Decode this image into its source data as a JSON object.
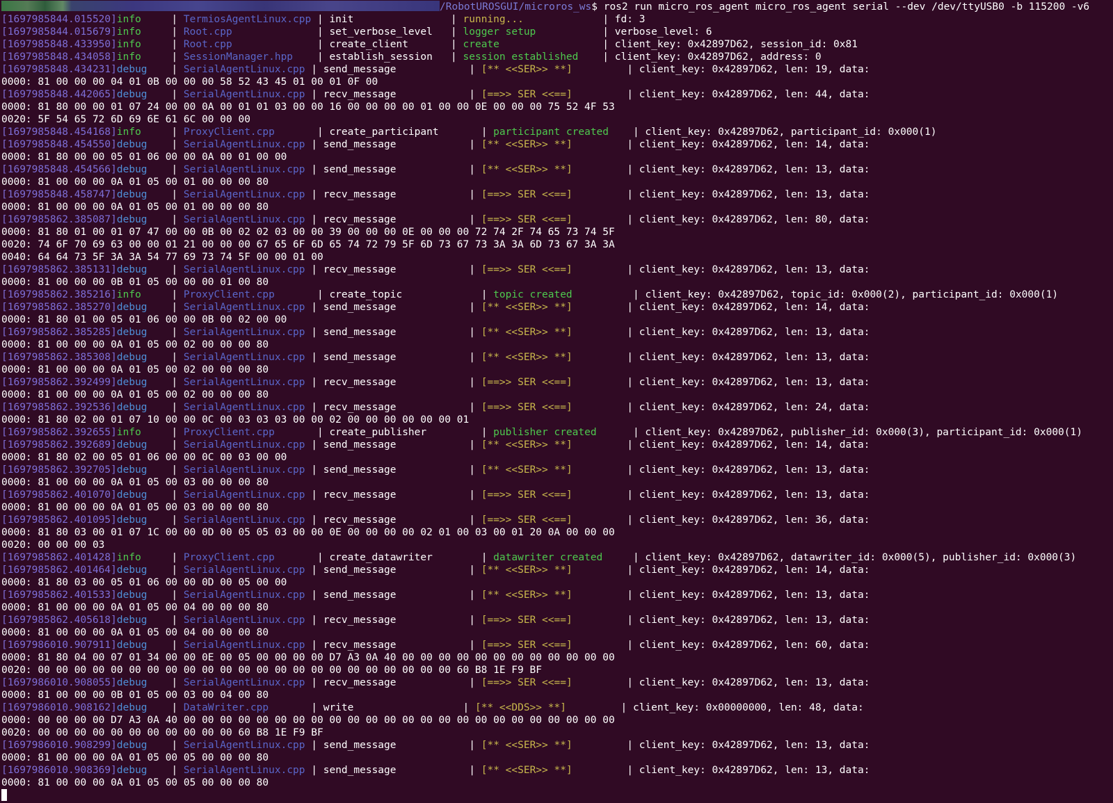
{
  "theme": {
    "background": "#300a24",
    "text": "#ffffff",
    "timestamp": "#7e6fd8",
    "info": "#4ec94e",
    "debug": "#4f8fd8",
    "source": "#5a66c9",
    "status_green": "#4ec94e",
    "status_yellow": "#c9b84c",
    "path": "#7b7bd6"
  },
  "prompt": {
    "path": "/RobotUROSGUI/microros_ws",
    "command": "$ ros2 run micro_ros_agent micro_ros_agent serial --dev /dev/ttyUSB0 -b 115200 -v6"
  },
  "lines": [
    {
      "type": "log",
      "ts": "[1697985844.015520]",
      "level": "info",
      "sep1": "     | ",
      "src": "TermiosAgentLinux.cpp",
      "sep2": " | ",
      "func": "init",
      "pad": "                ",
      "sep3": "| ",
      "status": "running...",
      "status_color": "yellow",
      "sep4": "             | ",
      "msg": "fd: 3"
    },
    {
      "type": "log",
      "ts": "[1697985844.015679]",
      "level": "info",
      "sep1": "     | ",
      "src": "Root.cpp",
      "sep2": "              | ",
      "func": "set_verbose_level",
      "pad": "   ",
      "sep3": "| ",
      "status": "logger setup",
      "status_color": "green",
      "sep4": "           | ",
      "msg": "verbose_level: 6"
    },
    {
      "type": "log",
      "ts": "[1697985848.433950]",
      "level": "info",
      "sep1": "     | ",
      "src": "Root.cpp",
      "sep2": "              | ",
      "func": "create_client",
      "pad": "       ",
      "sep3": "| ",
      "status": "create",
      "status_color": "green",
      "sep4": "                 | ",
      "msg": "client_key: 0x42897D62, session_id: 0x81"
    },
    {
      "type": "log",
      "ts": "[1697985848.434058]",
      "level": "info",
      "sep1": "     | ",
      "src": "SessionManager.hpp",
      "sep2": "    | ",
      "func": "establish_session",
      "pad": "   ",
      "sep3": "| ",
      "status": "session established",
      "status_color": "green",
      "sep4": "    | ",
      "msg": "client_key: 0x42897D62, address: 0"
    },
    {
      "type": "log",
      "ts": "[1697985848.434231]",
      "level": "debug",
      "sep1": "    | ",
      "src": "SerialAgentLinux.cpp",
      "sep2": " | ",
      "func": "send_message",
      "pad": "            ",
      "sep3": "| ",
      "status": "[** <<SER>> **]",
      "status_color": "yellow",
      "sep4": "         | ",
      "msg": "client_key: 0x42897D62, len: 19, data:"
    },
    {
      "type": "hex",
      "text": "0000: 81 00 00 00 04 01 0B 00 00 00 58 52 43 45 01 00 01 0F 00"
    },
    {
      "type": "log",
      "ts": "[1697985848.442065]",
      "level": "debug",
      "sep1": "    | ",
      "src": "SerialAgentLinux.cpp",
      "sep2": " | ",
      "func": "recv_message",
      "pad": "            ",
      "sep3": "| ",
      "status": "[==>> SER <<==]",
      "status_color": "yellow",
      "sep4": "         | ",
      "msg": "client_key: 0x42897D62, len: 44, data:"
    },
    {
      "type": "hex",
      "text": "0000: 81 80 00 00 01 07 24 00 00 0A 00 01 01 03 00 00 16 00 00 00 00 01 00 00 0E 00 00 00 75 52 4F 53"
    },
    {
      "type": "hex",
      "text": "0020: 5F 54 65 72 6D 69 6E 61 6C 00 00 00"
    },
    {
      "type": "log",
      "ts": "[1697985848.454168]",
      "level": "info",
      "sep1": "     | ",
      "src": "ProxyClient.cpp",
      "sep2": "       | ",
      "func": "create_participant",
      "pad": "       ",
      "sep3": "| ",
      "status": "participant created",
      "status_color": "green",
      "sep4": "    | ",
      "msg": "client_key: 0x42897D62, participant_id: 0x000(1)"
    },
    {
      "type": "log",
      "ts": "[1697985848.454550]",
      "level": "debug",
      "sep1": "    | ",
      "src": "SerialAgentLinux.cpp",
      "sep2": " | ",
      "func": "send_message",
      "pad": "            ",
      "sep3": "| ",
      "status": "[** <<SER>> **]",
      "status_color": "yellow",
      "sep4": "         | ",
      "msg": "client_key: 0x42897D62, len: 14, data:"
    },
    {
      "type": "hex",
      "text": "0000: 81 80 00 00 05 01 06 00 00 0A 00 01 00 00"
    },
    {
      "type": "log",
      "ts": "[1697985848.454566]",
      "level": "debug",
      "sep1": "    | ",
      "src": "SerialAgentLinux.cpp",
      "sep2": " | ",
      "func": "send_message",
      "pad": "            ",
      "sep3": "| ",
      "status": "[** <<SER>> **]",
      "status_color": "yellow",
      "sep4": "         | ",
      "msg": "client_key: 0x42897D62, len: 13, data:"
    },
    {
      "type": "hex",
      "text": "0000: 81 00 00 00 0A 01 05 00 01 00 00 00 80"
    },
    {
      "type": "log",
      "ts": "[1697985848.458747]",
      "level": "debug",
      "sep1": "    | ",
      "src": "SerialAgentLinux.cpp",
      "sep2": " | ",
      "func": "recv_message",
      "pad": "            ",
      "sep3": "| ",
      "status": "[==>> SER <<==]",
      "status_color": "yellow",
      "sep4": "         | ",
      "msg": "client_key: 0x42897D62, len: 13, data:"
    },
    {
      "type": "hex",
      "text": "0000: 81 00 00 00 0A 01 05 00 01 00 00 00 80"
    },
    {
      "type": "log",
      "ts": "[1697985862.385087]",
      "level": "debug",
      "sep1": "    | ",
      "src": "SerialAgentLinux.cpp",
      "sep2": " | ",
      "func": "recv_message",
      "pad": "            ",
      "sep3": "| ",
      "status": "[==>> SER <<==]",
      "status_color": "yellow",
      "sep4": "         | ",
      "msg": "client_key: 0x42897D62, len: 80, data:"
    },
    {
      "type": "hex",
      "text": "0000: 81 80 01 00 01 07 47 00 00 0B 00 02 02 03 00 00 39 00 00 00 0E 00 00 00 72 74 2F 74 65 73 74 5F"
    },
    {
      "type": "hex",
      "text": "0020: 74 6F 70 69 63 00 00 01 21 00 00 00 67 65 6F 6D 65 74 72 79 5F 6D 73 67 73 3A 3A 6D 73 67 3A 3A"
    },
    {
      "type": "hex",
      "text": "0040: 64 64 73 5F 3A 3A 54 77 69 73 74 5F 00 00 01 00"
    },
    {
      "type": "log",
      "ts": "[1697985862.385131]",
      "level": "debug",
      "sep1": "    | ",
      "src": "SerialAgentLinux.cpp",
      "sep2": " | ",
      "func": "recv_message",
      "pad": "            ",
      "sep3": "| ",
      "status": "[==>> SER <<==]",
      "status_color": "yellow",
      "sep4": "         | ",
      "msg": "client_key: 0x42897D62, len: 13, data:"
    },
    {
      "type": "hex",
      "text": "0000: 81 00 00 00 0B 01 05 00 00 00 01 00 80"
    },
    {
      "type": "log",
      "ts": "[1697985862.385216]",
      "level": "info",
      "sep1": "     | ",
      "src": "ProxyClient.cpp",
      "sep2": "       | ",
      "func": "create_topic",
      "pad": "             ",
      "sep3": "| ",
      "status": "topic created",
      "status_color": "green",
      "sep4": "          | ",
      "msg": "client_key: 0x42897D62, topic_id: 0x000(2), participant_id: 0x000(1)"
    },
    {
      "type": "log",
      "ts": "[1697985862.385270]",
      "level": "debug",
      "sep1": "    | ",
      "src": "SerialAgentLinux.cpp",
      "sep2": " | ",
      "func": "send_message",
      "pad": "            ",
      "sep3": "| ",
      "status": "[** <<SER>> **]",
      "status_color": "yellow",
      "sep4": "         | ",
      "msg": "client_key: 0x42897D62, len: 14, data:"
    },
    {
      "type": "hex",
      "text": "0000: 81 80 01 00 05 01 06 00 00 0B 00 02 00 00"
    },
    {
      "type": "log",
      "ts": "[1697985862.385285]",
      "level": "debug",
      "sep1": "    | ",
      "src": "SerialAgentLinux.cpp",
      "sep2": " | ",
      "func": "send_message",
      "pad": "            ",
      "sep3": "| ",
      "status": "[** <<SER>> **]",
      "status_color": "yellow",
      "sep4": "         | ",
      "msg": "client_key: 0x42897D62, len: 13, data:"
    },
    {
      "type": "hex",
      "text": "0000: 81 00 00 00 0A 01 05 00 02 00 00 00 80"
    },
    {
      "type": "log",
      "ts": "[1697985862.385308]",
      "level": "debug",
      "sep1": "    | ",
      "src": "SerialAgentLinux.cpp",
      "sep2": " | ",
      "func": "send_message",
      "pad": "            ",
      "sep3": "| ",
      "status": "[** <<SER>> **]",
      "status_color": "yellow",
      "sep4": "         | ",
      "msg": "client_key: 0x42897D62, len: 13, data:"
    },
    {
      "type": "hex",
      "text": "0000: 81 00 00 00 0A 01 05 00 02 00 00 00 80"
    },
    {
      "type": "log",
      "ts": "[1697985862.392499]",
      "level": "debug",
      "sep1": "    | ",
      "src": "SerialAgentLinux.cpp",
      "sep2": " | ",
      "func": "recv_message",
      "pad": "            ",
      "sep3": "| ",
      "status": "[==>> SER <<==]",
      "status_color": "yellow",
      "sep4": "         | ",
      "msg": "client_key: 0x42897D62, len: 13, data:"
    },
    {
      "type": "hex",
      "text": "0000: 81 00 00 00 0A 01 05 00 02 00 00 00 80"
    },
    {
      "type": "log",
      "ts": "[1697985862.392536]",
      "level": "debug",
      "sep1": "    | ",
      "src": "SerialAgentLinux.cpp",
      "sep2": " | ",
      "func": "recv_message",
      "pad": "            ",
      "sep3": "| ",
      "status": "[==>> SER <<==]",
      "status_color": "yellow",
      "sep4": "         | ",
      "msg": "client_key: 0x42897D62, len: 24, data:"
    },
    {
      "type": "hex",
      "text": "0000: 81 80 02 00 01 07 10 00 00 0C 00 03 03 03 00 00 02 00 00 00 00 00 00 01"
    },
    {
      "type": "log",
      "ts": "[1697985862.392655]",
      "level": "info",
      "sep1": "     | ",
      "src": "ProxyClient.cpp",
      "sep2": "       | ",
      "func": "create_publisher",
      "pad": "         ",
      "sep3": "| ",
      "status": "publisher created",
      "status_color": "green",
      "sep4": "      | ",
      "msg": "client_key: 0x42897D62, publisher_id: 0x000(3), participant_id: 0x000(1)"
    },
    {
      "type": "log",
      "ts": "[1697985862.392689]",
      "level": "debug",
      "sep1": "    | ",
      "src": "SerialAgentLinux.cpp",
      "sep2": " | ",
      "func": "send_message",
      "pad": "            ",
      "sep3": "| ",
      "status": "[** <<SER>> **]",
      "status_color": "yellow",
      "sep4": "         | ",
      "msg": "client_key: 0x42897D62, len: 14, data:"
    },
    {
      "type": "hex",
      "text": "0000: 81 80 02 00 05 01 06 00 00 0C 00 03 00 00"
    },
    {
      "type": "log",
      "ts": "[1697985862.392705]",
      "level": "debug",
      "sep1": "    | ",
      "src": "SerialAgentLinux.cpp",
      "sep2": " | ",
      "func": "send_message",
      "pad": "            ",
      "sep3": "| ",
      "status": "[** <<SER>> **]",
      "status_color": "yellow",
      "sep4": "         | ",
      "msg": "client_key: 0x42897D62, len: 13, data:"
    },
    {
      "type": "hex",
      "text": "0000: 81 00 00 00 0A 01 05 00 03 00 00 00 80"
    },
    {
      "type": "log",
      "ts": "[1697985862.401070]",
      "level": "debug",
      "sep1": "    | ",
      "src": "SerialAgentLinux.cpp",
      "sep2": " | ",
      "func": "recv_message",
      "pad": "            ",
      "sep3": "| ",
      "status": "[==>> SER <<==]",
      "status_color": "yellow",
      "sep4": "         | ",
      "msg": "client_key: 0x42897D62, len: 13, data:"
    },
    {
      "type": "hex",
      "text": "0000: 81 00 00 00 0A 01 05 00 03 00 00 00 80"
    },
    {
      "type": "log",
      "ts": "[1697985862.401095]",
      "level": "debug",
      "sep1": "    | ",
      "src": "SerialAgentLinux.cpp",
      "sep2": " | ",
      "func": "recv_message",
      "pad": "            ",
      "sep3": "| ",
      "status": "[==>> SER <<==]",
      "status_color": "yellow",
      "sep4": "         | ",
      "msg": "client_key: 0x42897D62, len: 36, data:"
    },
    {
      "type": "hex",
      "text": "0000: 81 80 03 00 01 07 1C 00 00 0D 00 05 05 03 00 00 0E 00 00 00 00 02 01 00 03 00 01 20 0A 00 00 00"
    },
    {
      "type": "hex",
      "text": "0020: 00 00 00 03"
    },
    {
      "type": "log",
      "ts": "[1697985862.401428]",
      "level": "info",
      "sep1": "     | ",
      "src": "ProxyClient.cpp",
      "sep2": "       | ",
      "func": "create_datawriter",
      "pad": "        ",
      "sep3": "| ",
      "status": "datawriter created",
      "status_color": "green",
      "sep4": "     | ",
      "msg": "client_key: 0x42897D62, datawriter_id: 0x000(5), publisher_id: 0x000(3)"
    },
    {
      "type": "log",
      "ts": "[1697985862.401464]",
      "level": "debug",
      "sep1": "    | ",
      "src": "SerialAgentLinux.cpp",
      "sep2": " | ",
      "func": "send_message",
      "pad": "            ",
      "sep3": "| ",
      "status": "[** <<SER>> **]",
      "status_color": "yellow",
      "sep4": "         | ",
      "msg": "client_key: 0x42897D62, len: 14, data:"
    },
    {
      "type": "hex",
      "text": "0000: 81 80 03 00 05 01 06 00 00 0D 00 05 00 00"
    },
    {
      "type": "log",
      "ts": "[1697985862.401533]",
      "level": "debug",
      "sep1": "    | ",
      "src": "SerialAgentLinux.cpp",
      "sep2": " | ",
      "func": "send_message",
      "pad": "            ",
      "sep3": "| ",
      "status": "[** <<SER>> **]",
      "status_color": "yellow",
      "sep4": "         | ",
      "msg": "client_key: 0x42897D62, len: 13, data:"
    },
    {
      "type": "hex",
      "text": "0000: 81 00 00 00 0A 01 05 00 04 00 00 00 80"
    },
    {
      "type": "log",
      "ts": "[1697985862.405618]",
      "level": "debug",
      "sep1": "    | ",
      "src": "SerialAgentLinux.cpp",
      "sep2": " | ",
      "func": "recv_message",
      "pad": "            ",
      "sep3": "| ",
      "status": "[==>> SER <<==]",
      "status_color": "yellow",
      "sep4": "         | ",
      "msg": "client_key: 0x42897D62, len: 13, data:"
    },
    {
      "type": "hex",
      "text": "0000: 81 00 00 00 0A 01 05 00 04 00 00 00 80"
    },
    {
      "type": "log",
      "ts": "[1697986010.907911]",
      "level": "debug",
      "sep1": "    | ",
      "src": "SerialAgentLinux.cpp",
      "sep2": " | ",
      "func": "recv_message",
      "pad": "            ",
      "sep3": "| ",
      "status": "[==>> SER <<==]",
      "status_color": "yellow",
      "sep4": "         | ",
      "msg": "client_key: 0x42897D62, len: 60, data:"
    },
    {
      "type": "hex",
      "text": "0000: 81 80 04 00 07 01 34 00 00 0E 00 05 00 00 00 00 D7 A3 0A 40 00 00 00 00 00 00 00 00 00 00 00 00"
    },
    {
      "type": "hex",
      "text": "0020: 00 00 00 00 00 00 00 00 00 00 00 00 00 00 00 00 00 00 00 00 00 00 00 60 B8 1E F9 BF"
    },
    {
      "type": "log",
      "ts": "[1697986010.908055]",
      "level": "debug",
      "sep1": "    | ",
      "src": "SerialAgentLinux.cpp",
      "sep2": " | ",
      "func": "recv_message",
      "pad": "            ",
      "sep3": "| ",
      "status": "[==>> SER <<==]",
      "status_color": "yellow",
      "sep4": "         | ",
      "msg": "client_key: 0x42897D62, len: 13, data:"
    },
    {
      "type": "hex",
      "text": "0000: 81 00 00 00 0B 01 05 00 03 00 04 00 80"
    },
    {
      "type": "log",
      "ts": "[1697986010.908162]",
      "level": "debug",
      "sep1": "    | ",
      "src": "DataWriter.cpp",
      "sep2": "       | ",
      "func": "write",
      "pad": "                  ",
      "sep3": "| ",
      "status": "[** <<DDS>> **]",
      "status_color": "yellow",
      "sep4": "         | ",
      "msg": "client_key: 0x00000000, len: 48, data:"
    },
    {
      "type": "hex",
      "text": "0000: 00 00 00 00 D7 A3 0A 40 00 00 00 00 00 00 00 00 00 00 00 00 00 00 00 00 00 00 00 00 00 00 00 00"
    },
    {
      "type": "hex",
      "text": "0020: 00 00 00 00 00 00 00 00 00 00 00 60 B8 1E F9 BF"
    },
    {
      "type": "log",
      "ts": "[1697986010.908299]",
      "level": "debug",
      "sep1": "    | ",
      "src": "SerialAgentLinux.cpp",
      "sep2": " | ",
      "func": "send_message",
      "pad": "            ",
      "sep3": "| ",
      "status": "[** <<SER>> **]",
      "status_color": "yellow",
      "sep4": "         | ",
      "msg": "client_key: 0x42897D62, len: 13, data:"
    },
    {
      "type": "hex",
      "text": "0000: 81 00 00 00 0A 01 05 00 05 00 00 00 80"
    },
    {
      "type": "log",
      "ts": "[1697986010.908369]",
      "level": "debug",
      "sep1": "    | ",
      "src": "SerialAgentLinux.cpp",
      "sep2": " | ",
      "func": "send_message",
      "pad": "            ",
      "sep3": "| ",
      "status": "[** <<SER>> **]",
      "status_color": "yellow",
      "sep4": "         | ",
      "msg": "client_key: 0x42897D62, len: 13, data:"
    },
    {
      "type": "hex",
      "text": "0000: 81 00 00 00 0A 01 05 00 05 00 00 00 80"
    }
  ]
}
